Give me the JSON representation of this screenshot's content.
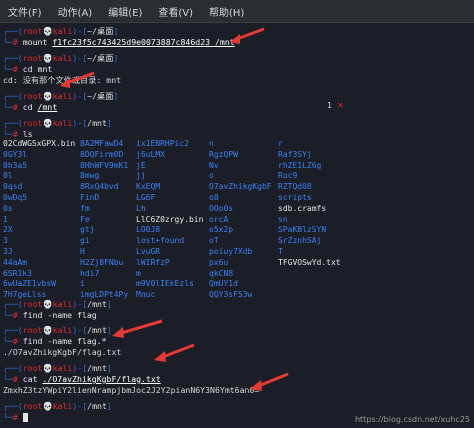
{
  "menu": [
    "文件(F)",
    "动作(A)",
    "编辑(E)",
    "查看(V)",
    "帮助(H)"
  ],
  "prompt": {
    "user": "root",
    "skull": "💀",
    "host": "kali"
  },
  "blocks": [
    {
      "path": "~/桌面",
      "cmd": "mount",
      "arg": "f1fc23f5c743425d9e0073887c846d23 /mnt"
    },
    {
      "path": "~/桌面",
      "cmd": "cd",
      "arg": "mnt"
    },
    {
      "output": "cd: 没有那个文件或目录: mnt"
    },
    {
      "path": "~/桌面",
      "cmd": "cd",
      "arg": "/mnt",
      "badge_num": "1",
      "badge_x": "✕"
    },
    {
      "path": "/mnt",
      "cmd": "ls",
      "arg": ""
    }
  ],
  "ls": {
    "columns": [
      [
        "02CdWGSxGPX.bin",
        "0GY3l",
        "0h3a5",
        "0l",
        "0qsd",
        "0wDq5",
        "0s",
        "1",
        "2X",
        "3",
        "3J",
        "44aAm",
        "6SR1k3",
        "6wUaZE1vbsW",
        "7H7geLlss"
      ],
      [
        "8A2MFawD4",
        "8DQFirm0D",
        "8HhWFV9mK1",
        "8mwg",
        "8RxQ4bvd",
        "FinD",
        "fm",
        "Fe",
        "gtj",
        "gi",
        "H",
        "H2Zj8FNbu",
        "hdi7",
        "i",
        "imgLDPt4Py"
      ],
      [
        "ix1ENRHPic2",
        "j6uLMX",
        "jE",
        "jj",
        "KxEQM",
        "LG6F",
        "Lh",
        "LlC6Z0zrgy.bin",
        "LO0J8",
        "lost+found",
        "LvuGR",
        "lWIRfzP",
        "m",
        "m9V0lIEkEzls",
        "Mnuc"
      ],
      [
        "n",
        "RgzQPW",
        "Nv",
        "o",
        "O7avZhikgKgbF",
        "o8",
        "OOo0s",
        "orcA",
        "o5x2p",
        "oT",
        "poiuy7Xdb",
        "px6u",
        "qkCN8",
        "QmUY1d",
        "QQY3sF53w"
      ],
      [
        "r",
        "Raf3SYj",
        "rhZE1LZ6g",
        "Ruc9",
        "RZTQd08",
        "scripts",
        "sdb.cramfs",
        "sn",
        "SPaKBlzSYN",
        "SrZznhSAj",
        "T",
        "TFGVOSwYd.txt",
        "",
        "",
        ""
      ]
    ]
  },
  "blocks2": [
    {
      "path": "/mnt",
      "cmd": "find",
      "arg": "-name flag"
    },
    {
      "path": "/mnt",
      "cmd": "find",
      "arg": "-name flag.*"
    },
    {
      "output": "./O7avZhikgKgbF/flag.txt"
    },
    {
      "path": "/mnt",
      "cmd": "cat",
      "arg": "./O7avZhikgKgbF/flag.txt"
    },
    {
      "output": "ZmxhZ3tzYWpiY2lienNrampjbmJoc2J2Y2pianN6Y3N6Ymt6an0="
    },
    {
      "path": "/mnt",
      "cmd": "",
      "arg": ""
    }
  ],
  "watermark": "https://blog.csdn.net/xuhc25"
}
